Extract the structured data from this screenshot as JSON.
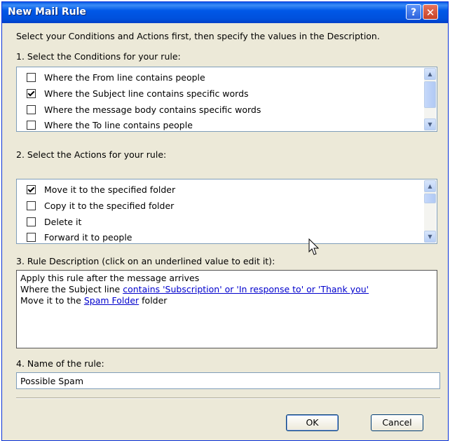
{
  "window": {
    "title": "New Mail Rule",
    "help_label": "?",
    "close_label": "✕"
  },
  "instructions": "Select your Conditions and Actions first, then specify the values in the Description.",
  "conditions": {
    "label": "1. Select the Conditions for your rule:",
    "items": [
      {
        "label": "Where the From line contains people",
        "checked": false
      },
      {
        "label": "Where the Subject line contains specific words",
        "checked": true
      },
      {
        "label": "Where the message body contains specific words",
        "checked": false
      },
      {
        "label": "Where the To line contains people",
        "checked": false
      }
    ]
  },
  "actions": {
    "label": "2. Select the Actions for your rule:",
    "items": [
      {
        "label": "Move it to the specified folder",
        "checked": true
      },
      {
        "label": "Copy it to the specified folder",
        "checked": false
      },
      {
        "label": "Delete it",
        "checked": false
      },
      {
        "label": "Forward it to people",
        "checked": false
      }
    ]
  },
  "description": {
    "label": "3. Rule Description (click on an underlined value to edit it):",
    "line1": "Apply this rule after the message arrives",
    "line2_prefix": "Where the Subject line ",
    "line2_link": "contains 'Subscription' or 'In response to' or 'Thank you'",
    "line3_prefix": "Move it to the ",
    "line3_link": "Spam Folder",
    "line3_suffix": " folder"
  },
  "rule_name": {
    "label": "4. Name of the rule:",
    "value": "Possible Spam"
  },
  "buttons": {
    "ok": "OK",
    "cancel": "Cancel"
  },
  "icons": {
    "scroll_up": "scroll-up-arrow-icon",
    "scroll_down": "scroll-down-arrow-icon",
    "cursor": "mouse-pointer-icon"
  },
  "colors": {
    "titlebar": "#0054e3",
    "link": "#0000cc",
    "dialog_bg": "#ece9d8"
  }
}
